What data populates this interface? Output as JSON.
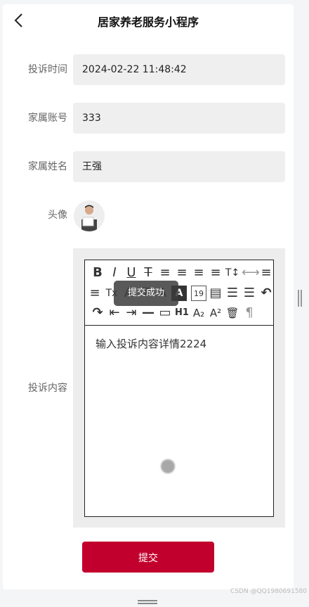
{
  "nav": {
    "title": "居家养老服务小程序"
  },
  "form": {
    "complaint_time": {
      "label": "投诉时间",
      "value": "2024-02-22 11:48:42"
    },
    "account": {
      "label": "家属账号",
      "value": "333"
    },
    "name": {
      "label": "家属姓名",
      "value": "王强"
    },
    "avatar": {
      "label": "头像"
    },
    "content": {
      "label": "投诉内容",
      "value": "输入投诉内容详情2224"
    }
  },
  "toolbar": {
    "row1": [
      "B",
      "I",
      "U",
      "T",
      "≡",
      "≡",
      "≡",
      "≡",
      "T↕",
      "⟷",
      "≡"
    ],
    "row2": [
      "≡",
      "Tx",
      "A",
      "T",
      "A",
      "A",
      "19",
      "▤",
      "☰",
      "☰",
      "↶"
    ],
    "row3": [
      "↷",
      "⇤",
      "⇥",
      "—",
      "▭",
      "H1",
      "A₂",
      "A²",
      "🗑",
      "¶"
    ]
  },
  "toast": {
    "text": "提交成功"
  },
  "submit": {
    "label": "提交"
  },
  "watermark": {
    "text": "CSDN @QQ1980691580"
  },
  "colors": {
    "accent": "#c2002d",
    "field_bg": "#efefef"
  }
}
